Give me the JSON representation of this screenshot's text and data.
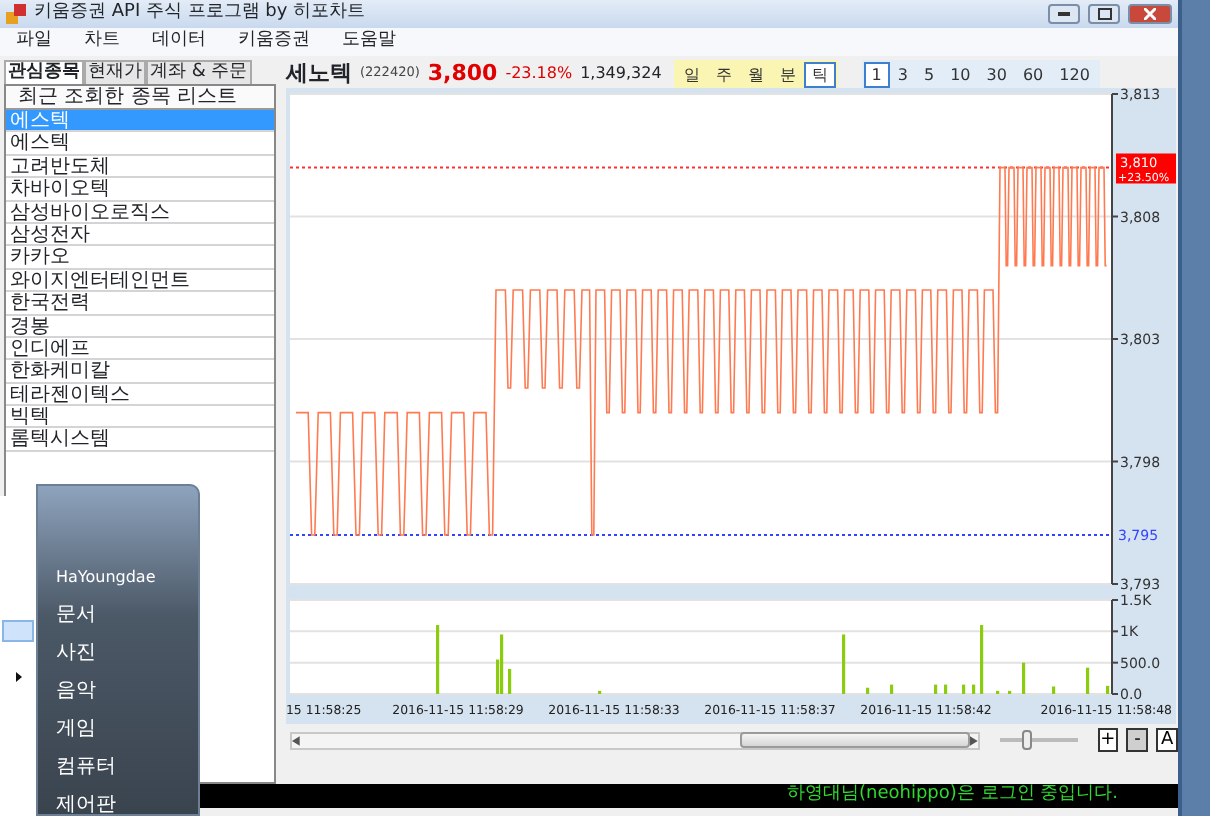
{
  "window": {
    "title": "키움증권 API 주식 프로그램 by 히포차트"
  },
  "menu": [
    "파일",
    "차트",
    "데이터",
    "키움증권",
    "도움말"
  ],
  "left_panel": {
    "tabs": [
      {
        "label": "관심종목",
        "selected": true
      },
      {
        "label": "현재가",
        "selected": false
      },
      {
        "label": "계좌 & 주문",
        "selected": false
      }
    ],
    "list_header": "최근 조회한 종목 리스트",
    "items": [
      {
        "label": "에스텍",
        "selected": true
      },
      {
        "label": "에스텍",
        "selected": false
      },
      {
        "label": "고려반도체",
        "selected": false
      },
      {
        "label": "차바이오텍",
        "selected": false
      },
      {
        "label": "삼성바이오로직스",
        "selected": false
      },
      {
        "label": "삼성전자",
        "selected": false
      },
      {
        "label": "카카오",
        "selected": false
      },
      {
        "label": "와이지엔터테인먼트",
        "selected": false
      },
      {
        "label": "한국전력",
        "selected": false
      },
      {
        "label": "경봉",
        "selected": false
      },
      {
        "label": "인디에프",
        "selected": false
      },
      {
        "label": "한화케미칼",
        "selected": false
      },
      {
        "label": "테라젠이텍스",
        "selected": false
      },
      {
        "label": "빅텍",
        "selected": false
      },
      {
        "label": "롬텍시스템",
        "selected": false
      }
    ]
  },
  "stock": {
    "name": "세노텍",
    "code": "(222420)",
    "price": "3,800",
    "change": "-23.18%",
    "volume": "1,349,324"
  },
  "period_buttons": [
    {
      "label": "일",
      "selected": false
    },
    {
      "label": "주",
      "selected": false
    },
    {
      "label": "월",
      "selected": false
    },
    {
      "label": "분",
      "selected": false
    },
    {
      "label": "틱",
      "selected": true
    }
  ],
  "interval_buttons": [
    {
      "label": "1",
      "selected": true
    },
    {
      "label": "3",
      "selected": false
    },
    {
      "label": "5",
      "selected": false
    },
    {
      "label": "10",
      "selected": false
    },
    {
      "label": "30",
      "selected": false
    },
    {
      "label": "60",
      "selected": false
    },
    {
      "label": "120",
      "selected": false
    }
  ],
  "chart": {
    "price_ticks": [
      "3,813",
      "3,808",
      "3,803",
      "3,798",
      "3,793"
    ],
    "high_marker": {
      "price": "3,810",
      "change": "+23.50%"
    },
    "low_marker": "3,795",
    "volume_ticks": [
      "1.5K",
      "1K",
      "500.0",
      "0.0"
    ],
    "time_labels": [
      "15 11:58:25",
      "2016-11-15 11:58:29",
      "2016-11-15 11:58:33",
      "2016-11-15 11:58:37",
      "2016-11-15 11:58:42",
      "2016-11-15 11:58:48"
    ]
  },
  "zoom_slider": {
    "level": 0.35
  },
  "zoom_buttons": [
    "+",
    "-",
    "A"
  ],
  "status_bar": "하영대님(neohippo)은 로그인 중입니다.",
  "start_menu": {
    "user": "HaYoungdae",
    "items": [
      "문서",
      "사진",
      "음악",
      "게임",
      "컴퓨터",
      "제어판"
    ]
  }
}
